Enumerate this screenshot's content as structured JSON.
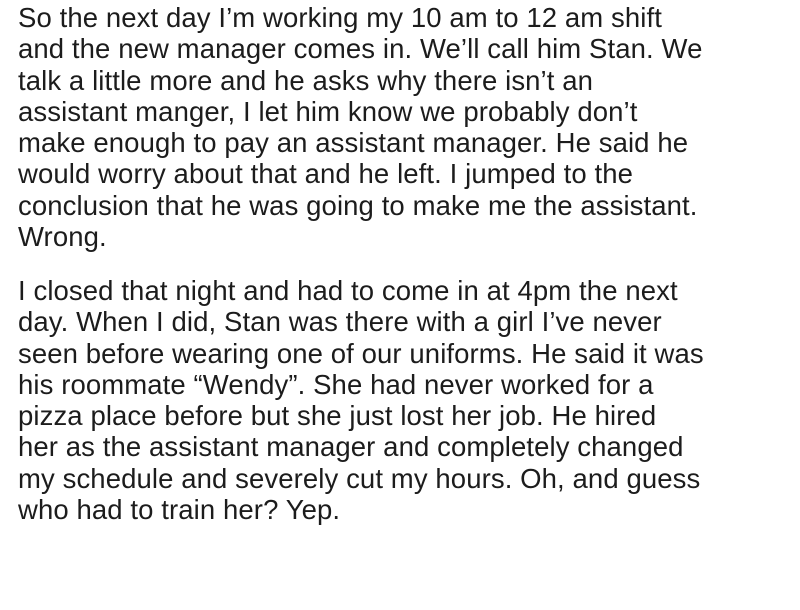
{
  "paragraphs": [
    {
      "lines": [
        "So the next day I’m working my 10 am to 12 am shift",
        "and the new manager comes in. We’ll call him Stan. We",
        "talk a little more and he asks why there isn’t an",
        "assistant manger, I let him know we probably don’t",
        "make enough to pay an assistant manager. He said he",
        "would worry about that and he left. I jumped to the",
        "conclusion that he was going to make me the assistant.",
        "Wrong."
      ]
    },
    {
      "lines": [
        "I closed that night and had to come in at 4pm the next",
        "day. When I did, Stan was there with a girl I’ve never",
        "seen before wearing one of our uniforms. He said it was",
        "his roommate “Wendy”. She had never worked for a",
        "pizza place before but she just lost her job. He hired",
        "her as the assistant manager and completely changed",
        "my schedule and severely cut my hours. Oh, and guess",
        "who had to train her? Yep."
      ]
    }
  ]
}
